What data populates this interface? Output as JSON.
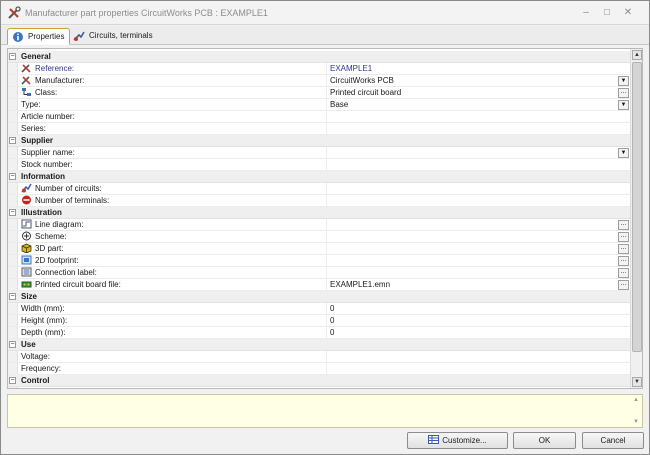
{
  "window": {
    "title": "Manufacturer part properties CircuitWorks PCB : EXAMPLE1",
    "controls": {
      "minimize": "–",
      "maximize": "□",
      "close": "✕"
    }
  },
  "tabs": [
    {
      "label": "Properties",
      "active": true,
      "icon": "properties-info-icon"
    },
    {
      "label": "Circuits, terminals",
      "active": false,
      "icon": "circuits-icon"
    }
  ],
  "sections": {
    "general": {
      "label": "General",
      "rows": {
        "reference": {
          "name": "Reference:",
          "value": "EXAMPLE1",
          "icon": "wrench-screwdriver-icon"
        },
        "manufacturer": {
          "name": "Manufacturer:",
          "value": "CircuitWorks PCB",
          "icon": "wrench-screwdriver-icon"
        },
        "class": {
          "name": "Class:",
          "value": "Printed circuit board",
          "icon": "class-tree-icon"
        },
        "type": {
          "name": "Type:",
          "value": "Base"
        },
        "article": {
          "name": "Article number:",
          "value": ""
        },
        "series": {
          "name": "Series:",
          "value": ""
        }
      }
    },
    "supplier": {
      "label": "Supplier",
      "rows": {
        "supplier_name": {
          "name": "Supplier name:",
          "value": ""
        },
        "stock_number": {
          "name": "Stock number:",
          "value": ""
        }
      }
    },
    "information": {
      "label": "Information",
      "rows": {
        "circuits": {
          "name": "Number of circuits:",
          "value": "",
          "icon": "circuits-icon"
        },
        "terminals": {
          "name": "Number of terminals:",
          "value": "",
          "icon": "terminal-red-icon"
        }
      }
    },
    "illustration": {
      "label": "Illustration",
      "rows": {
        "line_diagram": {
          "name": "Line diagram:",
          "value": "",
          "icon": "line-diagram-icon"
        },
        "scheme": {
          "name": "Scheme:",
          "value": "",
          "icon": "scheme-icon"
        },
        "part3d": {
          "name": "3D part:",
          "value": "",
          "icon": "cube-3d-icon"
        },
        "footprint2d": {
          "name": "2D footprint:",
          "value": "",
          "icon": "footprint-2d-icon"
        },
        "connection_label": {
          "name": "Connection label:",
          "value": "",
          "icon": "connection-label-icon"
        },
        "pcb_file": {
          "name": "Printed circuit board file:",
          "value": "EXAMPLE1.emn",
          "icon": "pcb-file-icon"
        }
      }
    },
    "size": {
      "label": "Size",
      "rows": {
        "width": {
          "name": "Width (mm):",
          "value": "0"
        },
        "height": {
          "name": "Height (mm):",
          "value": "0"
        },
        "depth": {
          "name": "Depth (mm):",
          "value": "0"
        }
      }
    },
    "use": {
      "label": "Use",
      "rows": {
        "voltage": {
          "name": "Voltage:",
          "value": ""
        },
        "frequency": {
          "name": "Frequency:",
          "value": ""
        }
      }
    },
    "control": {
      "label": "Control"
    }
  },
  "buttons": {
    "customize": "Customize...",
    "ok": "OK",
    "cancel": "Cancel"
  },
  "glyphs": {
    "expanded": "−",
    "dropdown": "▼",
    "ellipsis": "...",
    "scroll_up": "▲",
    "scroll_down": "▼"
  },
  "colors": {
    "link": "#2d3a8c",
    "description_bg": "#ffffe5",
    "active_tab_border": "#c9a23a"
  }
}
